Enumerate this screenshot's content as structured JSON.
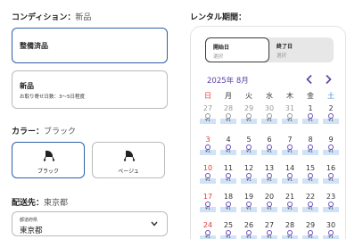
{
  "condition": {
    "label": "コンディション：",
    "value": "新品",
    "options": [
      {
        "title": "整備済品",
        "subtitle": ""
      },
      {
        "title": "新品",
        "subtitle": "お取り寄せ日数：3〜5日程度"
      }
    ]
  },
  "color": {
    "label": "カラー：",
    "value": "ブラック",
    "options": [
      {
        "label": "ブラック"
      },
      {
        "label": "ベージュ"
      }
    ]
  },
  "delivery": {
    "label": "配送先：",
    "value": "東京都",
    "field_label": "都道府県",
    "field_value": "東京都"
  },
  "rental": {
    "label": "レンタル期間：",
    "start_title": "開始日",
    "start_value": "選択",
    "end_title": "終了日",
    "end_value": "選択",
    "month_label": "2025年 8月",
    "weekdays": [
      "日",
      "月",
      "火",
      "水",
      "木",
      "金",
      "土"
    ],
    "weeks": [
      [
        {
          "day": "27",
          "price": "¥1"
        },
        {
          "day": "28",
          "price": "¥1"
        },
        {
          "day": "29",
          "price": "¥1"
        },
        {
          "day": "30",
          "price": "¥1"
        },
        {
          "day": "31",
          "price": "¥1"
        },
        {
          "day": "1",
          "price": "¥1"
        },
        {
          "day": "2",
          "price": "¥1"
        }
      ],
      [
        {
          "day": "3",
          "price": "¥1"
        },
        {
          "day": "4",
          "price": "¥1"
        },
        {
          "day": "5",
          "price": "¥1"
        },
        {
          "day": "6",
          "price": "¥1"
        },
        {
          "day": "7",
          "price": "¥1"
        },
        {
          "day": "8",
          "price": "¥1"
        },
        {
          "day": "9",
          "price": "¥1"
        }
      ],
      [
        {
          "day": "10",
          "price": "¥1"
        },
        {
          "day": "11",
          "price": "¥1"
        },
        {
          "day": "12",
          "price": "¥1"
        },
        {
          "day": "13",
          "price": "¥1"
        },
        {
          "day": "14",
          "price": "¥1"
        },
        {
          "day": "15",
          "price": "¥1"
        },
        {
          "day": "16",
          "price": "¥1"
        }
      ],
      [
        {
          "day": "17",
          "price": "¥1"
        },
        {
          "day": "18",
          "price": "¥1"
        },
        {
          "day": "19",
          "price": "¥1"
        },
        {
          "day": "20",
          "price": "¥1"
        },
        {
          "day": "21",
          "price": "¥1"
        },
        {
          "day": "22",
          "price": "¥1"
        },
        {
          "day": "23",
          "price": "¥1"
        }
      ],
      [
        {
          "day": "24",
          "price": "¥1"
        },
        {
          "day": "25",
          "price": "¥1"
        },
        {
          "day": "26",
          "price": "¥1"
        },
        {
          "day": "27",
          "price": "¥1"
        },
        {
          "day": "28",
          "price": "¥1"
        },
        {
          "day": "29",
          "price": "¥1"
        },
        {
          "day": "30",
          "price": "¥1"
        }
      ]
    ]
  },
  "colors": {
    "accent": "#2f5fa8",
    "calendar_accent": "#6d4cc2",
    "sunday": "#e53935",
    "price_bar": "#cfe2f8"
  },
  "icons": [
    "stroller-icon",
    "chevron-left-icon",
    "chevron-right-icon",
    "chevron-down-icon",
    "availability-dot-icon"
  ]
}
